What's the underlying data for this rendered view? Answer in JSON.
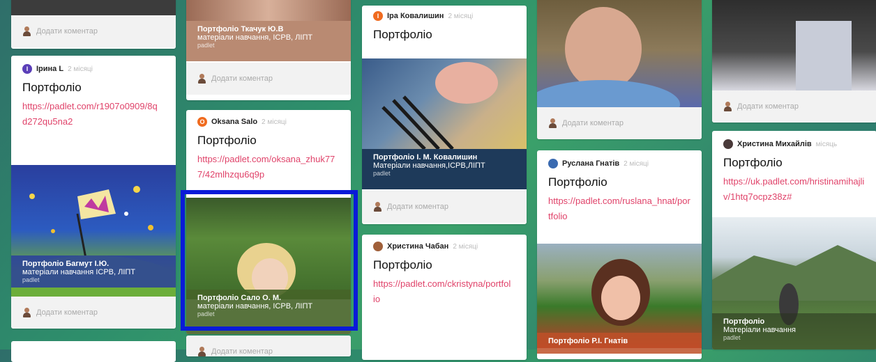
{
  "comment_placeholder": "Додати коментар",
  "columns": {
    "c1": {
      "comment_top": "Додати коментар",
      "card_irina": {
        "author": "Ірина L",
        "avatar_letter": "I",
        "time": "2 місяці",
        "title": "Портфоліо",
        "link": "https://padlet.com/r1907o0909/8qd272qu5na2",
        "caption_title": "Портфоліо Багмут І.Ю.",
        "caption_sub": "матеріали навчання ІСРВ, ЛІПТ",
        "caption_src": "padlet",
        "comment": "Додати коментар"
      }
    },
    "c2": {
      "card_tkachuk": {
        "caption_title": "Портфоліо Ткачук Ю.В",
        "caption_sub": "матеріали навчання, ІСРВ, ЛІПТ",
        "caption_src": "padlet",
        "comment": "Додати коментар"
      },
      "card_oksana": {
        "author": "Oksana Salo",
        "avatar_letter": "O",
        "time": "2 місяці",
        "title": "Портфоліо",
        "link": "https://padlet.com/oksana_zhuk777/42mlhzqu6q9p",
        "caption_title": "Портфоліо Сало О. М.",
        "caption_sub": "матеріали навчання, ІСРВ, ЛІПТ",
        "caption_src": "padlet",
        "comment": "Додати коментар"
      }
    },
    "c3": {
      "card_kovalyshyn": {
        "author": "Іра Ковалишин",
        "avatar_letter": "I",
        "time": "2 місяці",
        "title": "Портфоліо",
        "caption_title": "Портфоліо І. М. Ковалишин",
        "caption_sub": "Матеріали навчання,ІСРВ,ЛІПТ",
        "caption_src": "padlet",
        "comment": "Додати коментар"
      },
      "card_chaban": {
        "author": "Христина Чабан",
        "time": "2 місяці",
        "title": "Портфоліо",
        "link": "https://padlet.com/ckristyna/portfolio"
      }
    },
    "c4": {
      "comment_top": "Додати коментар",
      "card_hnativ": {
        "author": "Руслана Гнатів",
        "time": "2 місяці",
        "title": "Портфоліо",
        "link": "https://padlet.com/ruslana_hnat/portfolio",
        "caption_title": "Портфоліо Р.І. Гнатів"
      }
    },
    "c5": {
      "comment_top": "Додати коментар",
      "card_mykhailiv": {
        "author": "Христина Михайлів",
        "time": "місяць",
        "title": "Портфоліо",
        "link": "https://uk.padlet.com/hristinamihajliv/1htq7ocpz38z#",
        "caption_title": "Портфоліо",
        "caption_sub": "Матеріали навчання",
        "caption_src": "padlet"
      }
    }
  }
}
